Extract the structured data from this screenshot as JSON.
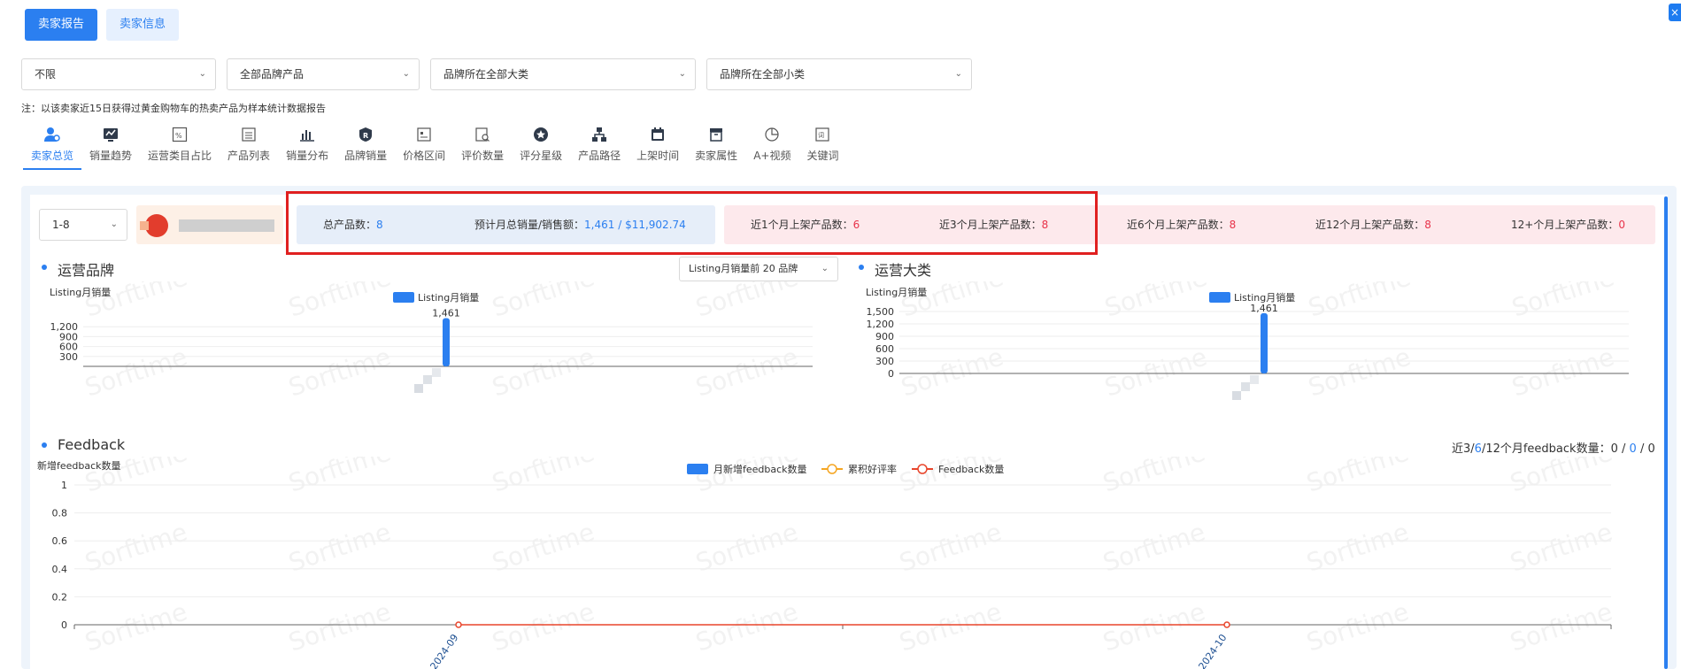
{
  "close_label": "×",
  "top_tabs": [
    {
      "label": "卖家报告",
      "active": true
    },
    {
      "label": "卖家信息",
      "active": false
    }
  ],
  "filters": [
    {
      "value": "不限"
    },
    {
      "value": "全部品牌产品"
    },
    {
      "value": "品牌所在全部大类"
    },
    {
      "value": "品牌所在全部小类"
    }
  ],
  "note": "注：以该卖家近15日获得过黄金购物车的热卖产品为样本统计数据报告",
  "icon_tabs": [
    {
      "label": "卖家总览",
      "icon": "seller-overview-icon",
      "active": true
    },
    {
      "label": "销量趋势",
      "icon": "sales-trend-icon"
    },
    {
      "label": "运营类目占比",
      "icon": "category-share-icon"
    },
    {
      "label": "产品列表",
      "icon": "product-list-icon"
    },
    {
      "label": "销量分布",
      "icon": "sales-distribution-icon"
    },
    {
      "label": "品牌销量",
      "icon": "brand-sales-icon"
    },
    {
      "label": "价格区间",
      "icon": "price-range-icon"
    },
    {
      "label": "评价数量",
      "icon": "review-count-icon"
    },
    {
      "label": "评分星级",
      "icon": "star-rating-icon"
    },
    {
      "label": "产品路径",
      "icon": "product-path-icon"
    },
    {
      "label": "上架时间",
      "icon": "listing-time-icon"
    },
    {
      "label": "卖家属性",
      "icon": "seller-attribute-icon"
    },
    {
      "label": "A+视频",
      "icon": "aplus-video-icon"
    },
    {
      "label": "关键词",
      "icon": "keyword-icon"
    }
  ],
  "page_select": "1-8",
  "stats": {
    "total_products_label": "总产品数：",
    "total_products_value": "8",
    "est_sales_label": "预计月总销量/销售额：",
    "est_sales_value": "1,461 / $11,902.74",
    "m1_label": "近1个月上架产品数：",
    "m1_value": "6",
    "m3_label": "近3个月上架产品数：",
    "m3_value": "8",
    "m6_label": "近6个月上架产品数：",
    "m6_value": "8",
    "m12_label": "近12个月上架产品数：",
    "m12_value": "8",
    "m12plus_label": "12+个月上架产品数：",
    "m12plus_value": "0"
  },
  "brand_section": {
    "title": "运营品牌",
    "dropdown": "Listing月销量前 20 品牌"
  },
  "category_section": {
    "title": "运营大类"
  },
  "feedback_section": {
    "title": "Feedback",
    "summary_prefix": "近3/",
    "summary_6": "6",
    "summary_mid": "/12个月feedback数量：",
    "summary_v1": "0",
    "summary_sep1": " / ",
    "summary_v2": "0",
    "summary_sep2": " / ",
    "summary_v3": "0"
  },
  "watermark": "Sorftime",
  "colors": {
    "accent": "#2b7ff0",
    "red": "#e8334a",
    "bar": "#2b7ff0",
    "rating_line": "#f5a623",
    "feedback_line": "#e8452b"
  },
  "chart_data": [
    {
      "type": "bar",
      "ylabel": "Listing月销量",
      "legend": [
        "Listing月销量"
      ],
      "series": [
        {
          "name": "Listing月销量",
          "values": [
            1461
          ]
        }
      ],
      "categories": [
        ""
      ],
      "data_labels": [
        "1,461"
      ],
      "yticks": [
        "1,200",
        "900",
        "600",
        "300"
      ],
      "ylim": [
        0,
        1500
      ]
    },
    {
      "type": "bar",
      "ylabel": "Listing月销量",
      "legend": [
        "Listing月销量"
      ],
      "series": [
        {
          "name": "Listing月销量",
          "values": [
            1461
          ]
        }
      ],
      "categories": [
        ""
      ],
      "data_labels": [
        "1,461"
      ],
      "yticks": [
        "1,500",
        "1,200",
        "900",
        "600",
        "300",
        "0"
      ],
      "ylim": [
        0,
        1500
      ]
    },
    {
      "type": "line",
      "ylabel": "新增feedback数量",
      "legend": [
        "月新增feedback数量",
        "累积好评率",
        "Feedback数量"
      ],
      "categories": [
        "2024-09",
        "2024-10"
      ],
      "series": [
        {
          "name": "月新增feedback数量",
          "values": [
            0,
            0
          ]
        },
        {
          "name": "累积好评率",
          "values": [
            0,
            0
          ]
        },
        {
          "name": "Feedback数量",
          "values": [
            0,
            0
          ]
        }
      ],
      "yticks": [
        "1",
        "0.8",
        "0.6",
        "0.4",
        "0.2",
        "0"
      ],
      "ylim": [
        0,
        1
      ]
    }
  ]
}
